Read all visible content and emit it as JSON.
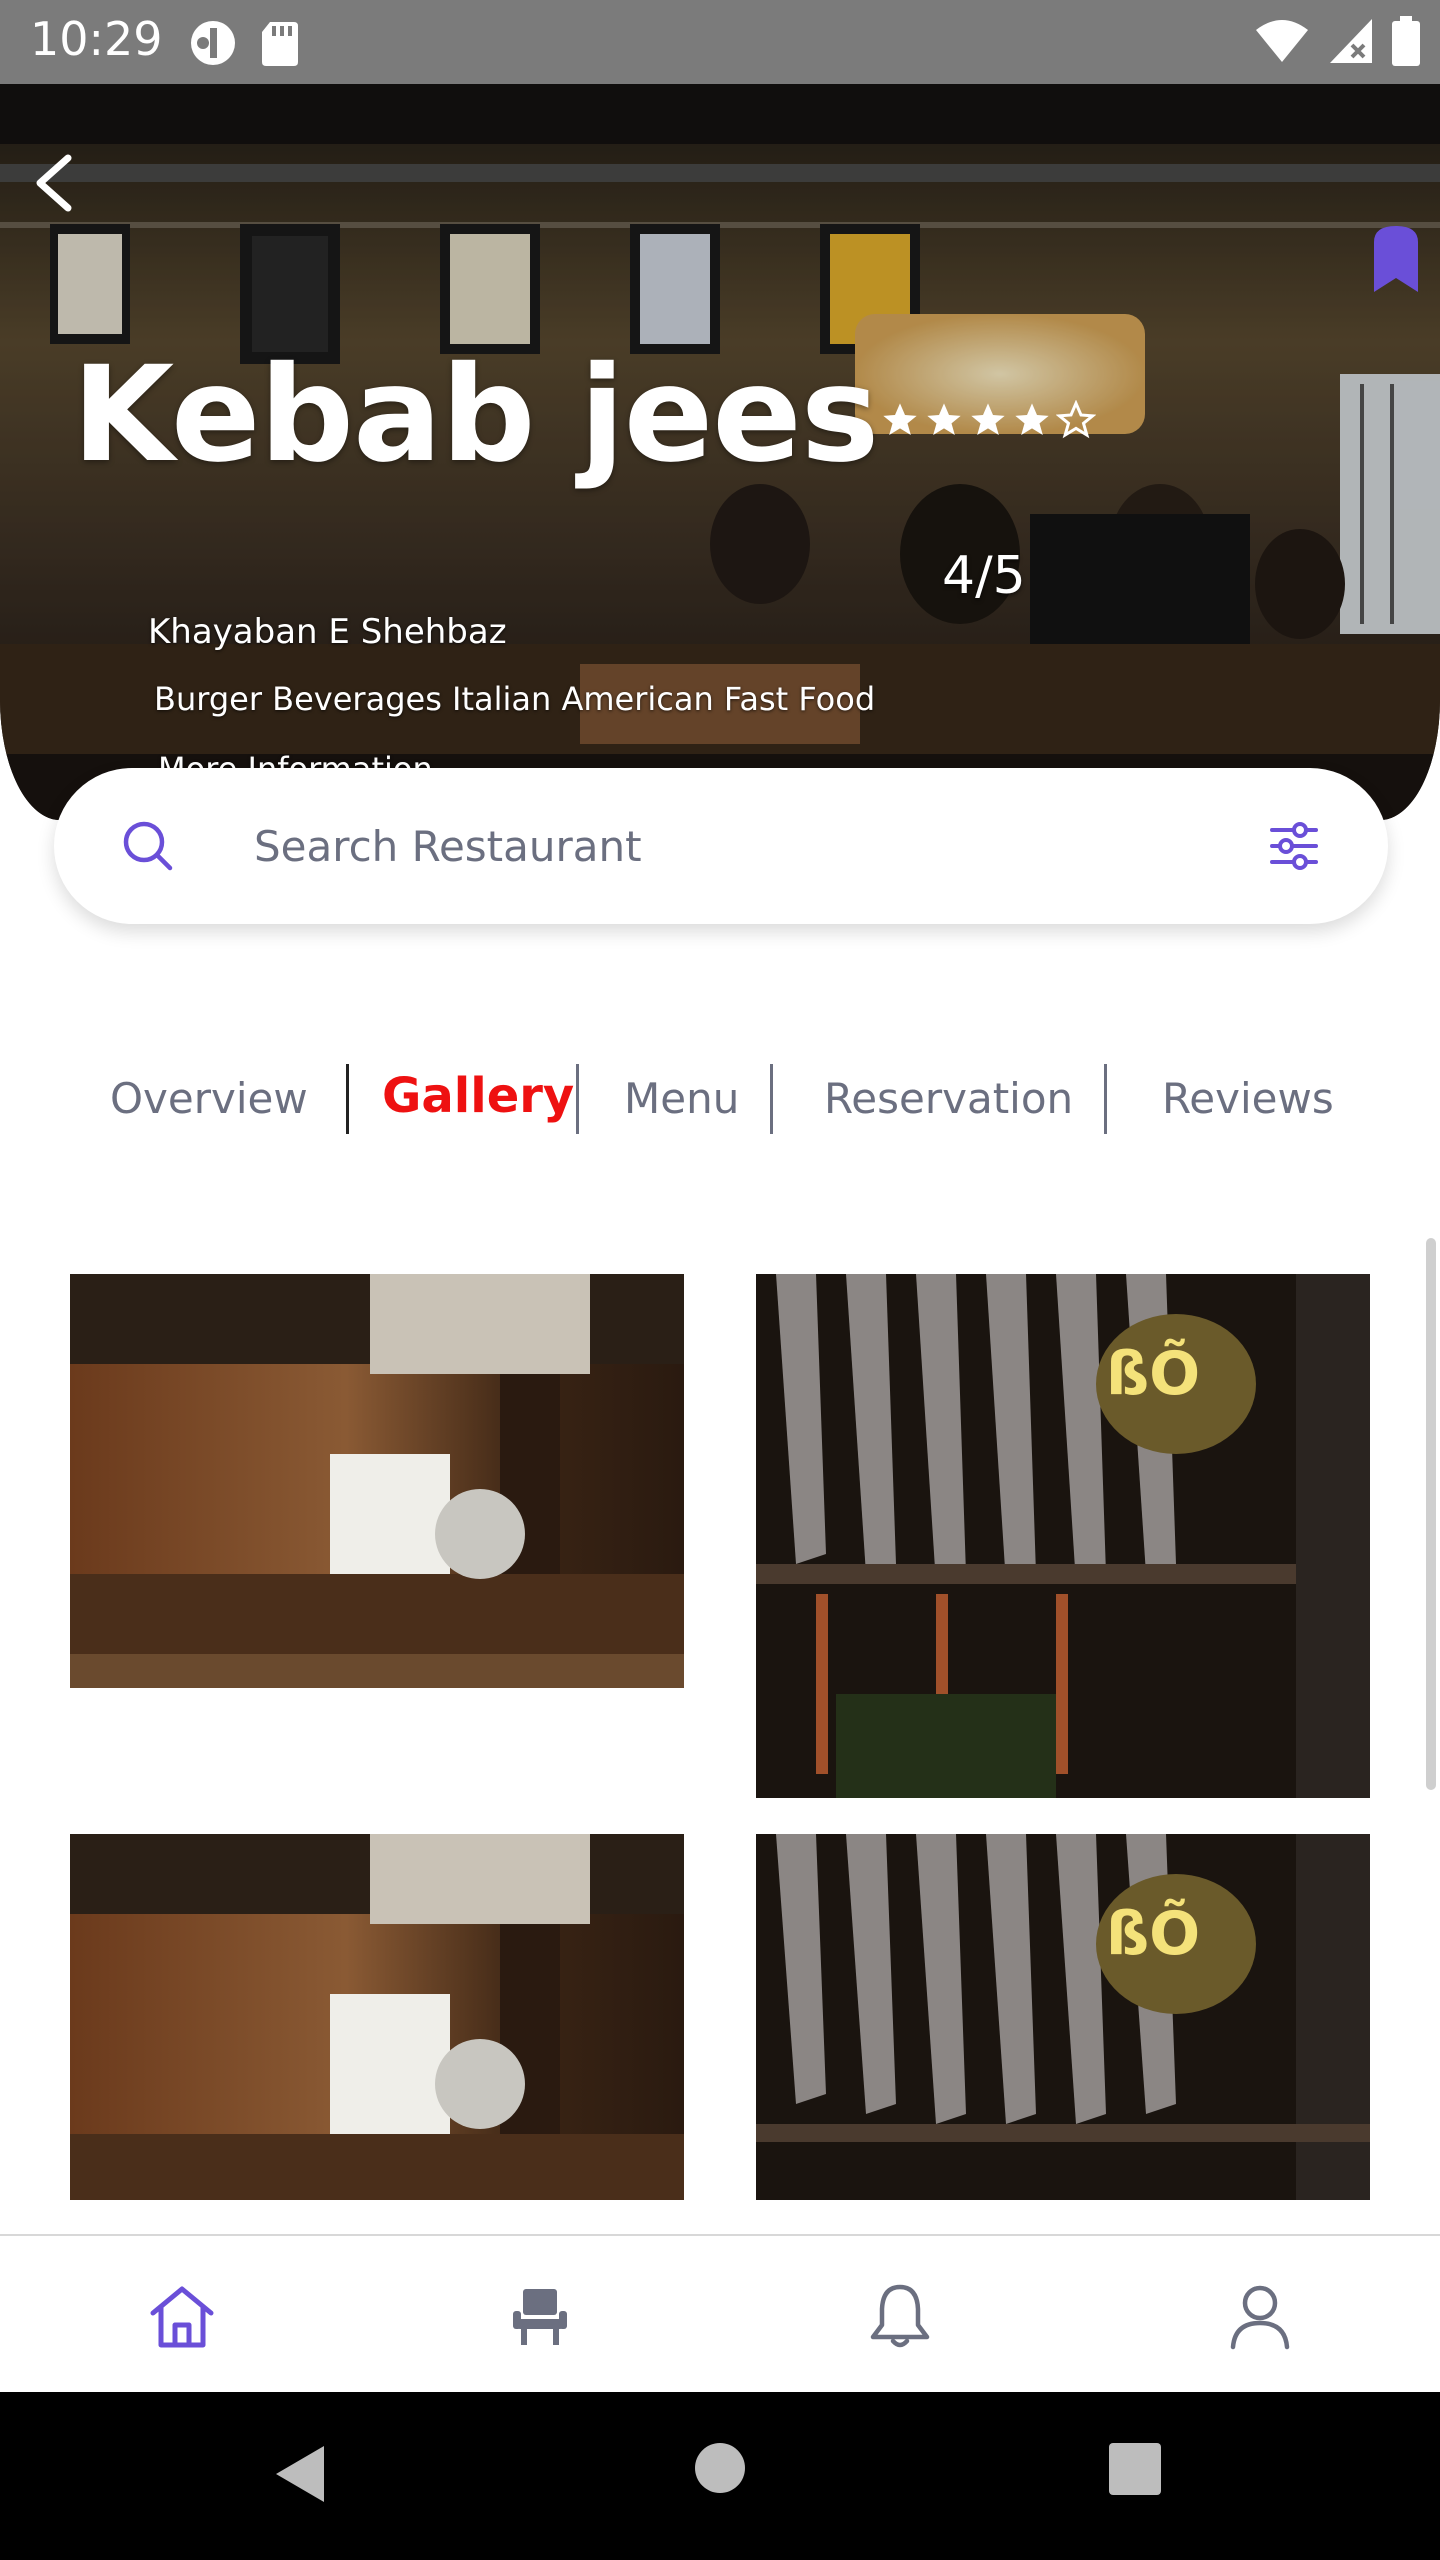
{
  "status_bar": {
    "time": "10:29",
    "icons": [
      "signal-icon",
      "sd-card-icon",
      "wifi-icon",
      "cellular-icon",
      "battery-icon"
    ]
  },
  "restaurant": {
    "name": "Kebab jees",
    "rating_text": "4/5",
    "rating_value": 4,
    "rating_max": 5,
    "area": "Khayaban E Shehbaz",
    "cuisines": "Burger Beverages Italian American Fast Food",
    "more_info": "More Information"
  },
  "search": {
    "placeholder": "Search Restaurant",
    "value": ""
  },
  "tabs": [
    {
      "label": "Overview",
      "active": false
    },
    {
      "label": "Gallery",
      "active": true
    },
    {
      "label": "Menu",
      "active": false
    },
    {
      "label": "Reservation",
      "active": false
    },
    {
      "label": "Reviews",
      "active": false
    }
  ],
  "bottom_nav": [
    {
      "icon": "home-icon",
      "active": true
    },
    {
      "icon": "chair-icon",
      "active": false
    },
    {
      "icon": "bell-icon",
      "active": false
    },
    {
      "icon": "user-icon",
      "active": false
    }
  ],
  "colors": {
    "accent": "#6a4fd8",
    "active_tab": "#ee1111",
    "muted": "#6b6f80",
    "status_bar": "#7b7b7b"
  }
}
